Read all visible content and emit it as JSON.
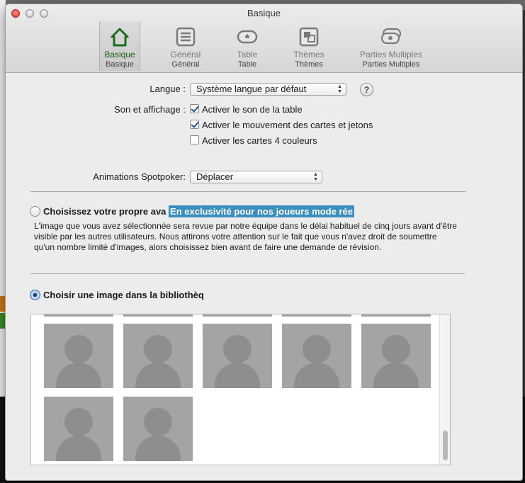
{
  "window": {
    "title": "Basique"
  },
  "tabs": [
    {
      "label": "Basique",
      "sub": "Basique",
      "icon": "home-icon",
      "active": true
    },
    {
      "label": "Général",
      "sub": "Général",
      "icon": "list-icon",
      "active": false
    },
    {
      "label": "Table",
      "sub": "Table",
      "icon": "poker-table-icon",
      "active": false
    },
    {
      "label": "Thèmes",
      "sub": "Thèmes",
      "icon": "themes-icon",
      "active": false
    },
    {
      "label": "Parties Multiples",
      "sub": "Parties Multiples",
      "icon": "multi-tables-icon",
      "active": false
    }
  ],
  "language": {
    "label": "Langue :",
    "value": "Système langue par défaut",
    "help": "?"
  },
  "sound": {
    "label": "Son et affichage :",
    "options": [
      {
        "label": "Activer le son de la table",
        "checked": true
      },
      {
        "label": "Activer le mouvement des cartes et jetons",
        "checked": true
      },
      {
        "label": "Activer les cartes 4 couleurs",
        "checked": false
      }
    ]
  },
  "animations": {
    "label": "Animations Spotpoker:",
    "value": "Déplacer"
  },
  "avatar": {
    "own": {
      "label": "Choisissez votre propre ava",
      "highlight": "En exclusivité pour nos joueurs mode rée",
      "description": "L'image que vous avez sélectionnée sera revue par notre équipe dans le délai habituel de cinq jours avant d'être visible par les autres utilisateurs. Nous attirons votre attention sur le fait que vous n'avez droit de soumettre qu'un nombre limité d'images, alors choisissez bien avant de faire une demande de révision.",
      "selected": false
    },
    "library": {
      "label": "Choisir une image dans la bibliothèq",
      "selected": true,
      "thumbnail_count": 7
    }
  },
  "colors": {
    "accent_highlight": "#3a8fc0",
    "active_tab_icon": "#1d6b1d"
  }
}
